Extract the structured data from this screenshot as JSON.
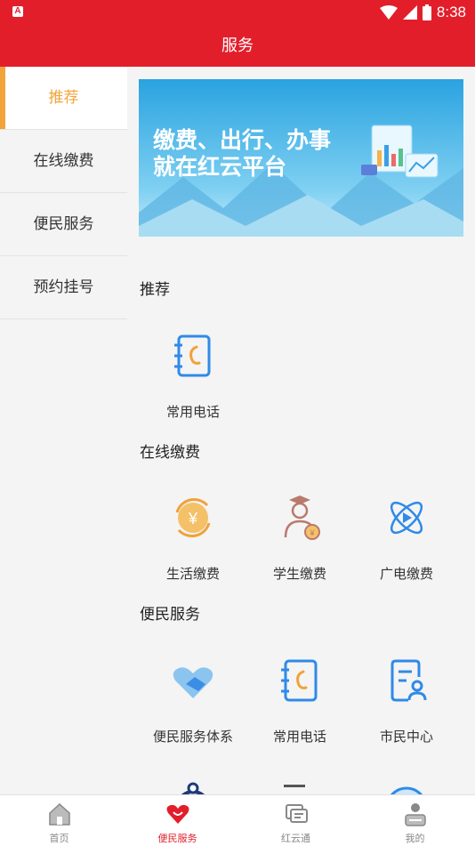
{
  "status": {
    "time": "8:38"
  },
  "header": {
    "title": "服务"
  },
  "sidebar": {
    "items": [
      {
        "label": "推荐"
      },
      {
        "label": "在线缴费"
      },
      {
        "label": "便民服务"
      },
      {
        "label": "预约挂号"
      }
    ]
  },
  "banner": {
    "line1": "缴费、出行、办事",
    "line2": "就在红云平台"
  },
  "sections": [
    {
      "title": "推荐",
      "items": [
        {
          "label": "常用电话",
          "icon": "phone-book-icon"
        }
      ]
    },
    {
      "title": "在线缴费",
      "items": [
        {
          "label": "生活缴费",
          "icon": "yen-cycle-icon"
        },
        {
          "label": "学生缴费",
          "icon": "student-icon"
        },
        {
          "label": "广电缴费",
          "icon": "atom-play-icon"
        }
      ]
    },
    {
      "title": "便民服务",
      "items": [
        {
          "label": "便民服务体系",
          "icon": "heart-hands-icon"
        },
        {
          "label": "常用电话",
          "icon": "phone-book-icon"
        },
        {
          "label": "市民中心",
          "icon": "person-doc-icon"
        }
      ]
    }
  ],
  "tabbar": {
    "items": [
      {
        "label": "首页",
        "icon": "home-icon"
      },
      {
        "label": "便民服务",
        "icon": "heart-icon"
      },
      {
        "label": "红云通",
        "icon": "chat-icon"
      },
      {
        "label": "我的",
        "icon": "user-icon"
      }
    ]
  },
  "colors": {
    "brand": "#e31e2b",
    "accent": "#f2a43a",
    "icon_blue": "#2f8ae8"
  }
}
